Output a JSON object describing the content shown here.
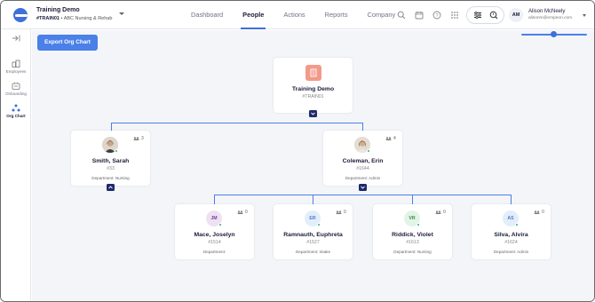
{
  "header": {
    "org_name": "Training Demo",
    "org_code": "#TRAIN01",
    "org_separator": "•",
    "org_facility": "ABC Nursing & Rehab",
    "nav": [
      "Dashboard",
      "People",
      "Actions",
      "Reports",
      "Company"
    ],
    "active_nav": "People",
    "user_initials": "AM",
    "user_name": "Alison McNeely",
    "user_email": "alisonm@empeon.com"
  },
  "sidebar": {
    "items": [
      {
        "label": "Employees",
        "icon": "employees-icon"
      },
      {
        "label": "Onboarding",
        "icon": "onboarding-icon"
      },
      {
        "label": "Org Chart",
        "icon": "org-chart-icon",
        "active": true
      }
    ]
  },
  "main": {
    "export_label": "Export Org Chart"
  },
  "org": {
    "root": {
      "name": "Training Demo",
      "id": "#TRAIN01"
    },
    "managers": [
      {
        "name": "Smith, Sarah",
        "id": "#33",
        "dept": "Department: Nursing",
        "count": "3"
      },
      {
        "name": "Coleman, Erin",
        "id": "#1644",
        "dept": "Department: Admin",
        "count": "4"
      }
    ],
    "reports": [
      {
        "initials": "JM",
        "name": "Mace, Joselyn",
        "id": "#1514",
        "dept": "Department:",
        "count": "0",
        "color": "#efe1f4",
        "text_color": "#7a3f95"
      },
      {
        "initials": "ER",
        "name": "Ramnauth, Euphreta",
        "id": "#1527",
        "dept": "Department: Intake",
        "count": "0",
        "color": "#e3eefb",
        "text_color": "#4a7ec8"
      },
      {
        "initials": "VR",
        "name": "Riddick, Violet",
        "id": "#1613",
        "dept": "Department: Nursing",
        "count": "0",
        "color": "#e2f4e6",
        "text_color": "#3c8a4e"
      },
      {
        "initials": "AS",
        "name": "Silva, Alvira",
        "id": "#1624",
        "dept": "Department: Admin",
        "count": "0",
        "color": "#e3eefb",
        "text_color": "#4a7ec8"
      }
    ]
  },
  "colors": {
    "accent": "#4a80e8",
    "toggle": "#1f2a6b",
    "online": "#2fb36b"
  }
}
